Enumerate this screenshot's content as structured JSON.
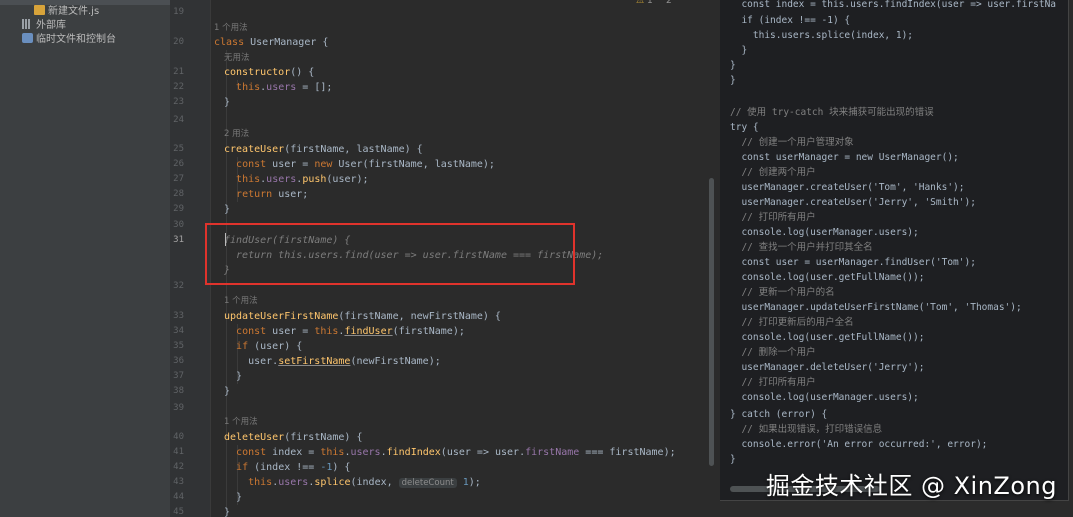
{
  "sidebar": {
    "items": [
      {
        "label": "新建文件.js",
        "icon": "js-file-icon"
      },
      {
        "label": "外部库",
        "icon": "library-icon"
      },
      {
        "label": "临时文件和控制台",
        "icon": "scratches-icon"
      }
    ]
  },
  "editor": {
    "status": {
      "warn_icon": "⚠",
      "warn_count": "1",
      "hint_count": "^ 2"
    },
    "line_numbers": [
      "19",
      "20",
      "21",
      "22",
      "23",
      "24",
      "25",
      "26",
      "27",
      "28",
      "29",
      "30",
      "31",
      "32",
      "33",
      "34",
      "35",
      "36",
      "37",
      "38",
      "39",
      "40",
      "41",
      "42",
      "43",
      "44",
      "45"
    ],
    "active_line": "31",
    "hints": {
      "class_usage": "1 个用法",
      "ctor_usage": "无用法",
      "create_usage": "2 用法",
      "update_usage": "1 个用法",
      "delete_usage": "1 个用法"
    },
    "inlay_delete_count": "deleteCount"
  },
  "right": {
    "code_lines": [
      "  const index = this.users.findIndex(user => user.firstNa",
      "  if (index !== -1) {",
      "    this.users.splice(index, 1);",
      "  }",
      "}",
      "}",
      "",
      "// 使用 try-catch 块来捕获可能出现的错误",
      "try {",
      "  // 创建一个用户管理对象",
      "  const userManager = new UserManager();",
      "  // 创建两个用户",
      "  userManager.createUser('Tom', 'Hanks');",
      "  userManager.createUser('Jerry', 'Smith');",
      "  // 打印所有用户",
      "  console.log(userManager.users);",
      "  // 查找一个用户并打印其全名",
      "  const user = userManager.findUser('Tom');",
      "  console.log(user.getFullName());",
      "  // 更新一个用户的名",
      "  userManager.updateUserFirstName('Tom', 'Thomas');",
      "  // 打印更新后的用户全名",
      "  console.log(user.getFullName());",
      "  // 删除一个用户",
      "  userManager.deleteUser('Jerry');",
      "  // 打印所有用户",
      "  console.log(userManager.users);",
      "} catch (error) {",
      "  // 如果出现错误，打印错误信息",
      "  console.error('An error occurred:', error);",
      "}"
    ]
  },
  "watermark": "掘金技术社区 @ XinZong"
}
